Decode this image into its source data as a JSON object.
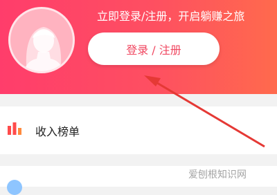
{
  "header": {
    "tagline": "立即登录/注册，开启躺赚之旅",
    "login_button": "登录 / 注册",
    "avatar_icon": "female-avatar-icon",
    "gradient_colors": [
      "#ff3d6b",
      "#ff6a4d"
    ]
  },
  "menu": {
    "items": [
      {
        "label": "收入榜单",
        "icon": "bar-chart-icon",
        "icon_color": "#ff4b4b"
      }
    ]
  },
  "annotation": {
    "arrow_color": "#e53935"
  },
  "watermark": {
    "text": "爱刨根知识网"
  }
}
